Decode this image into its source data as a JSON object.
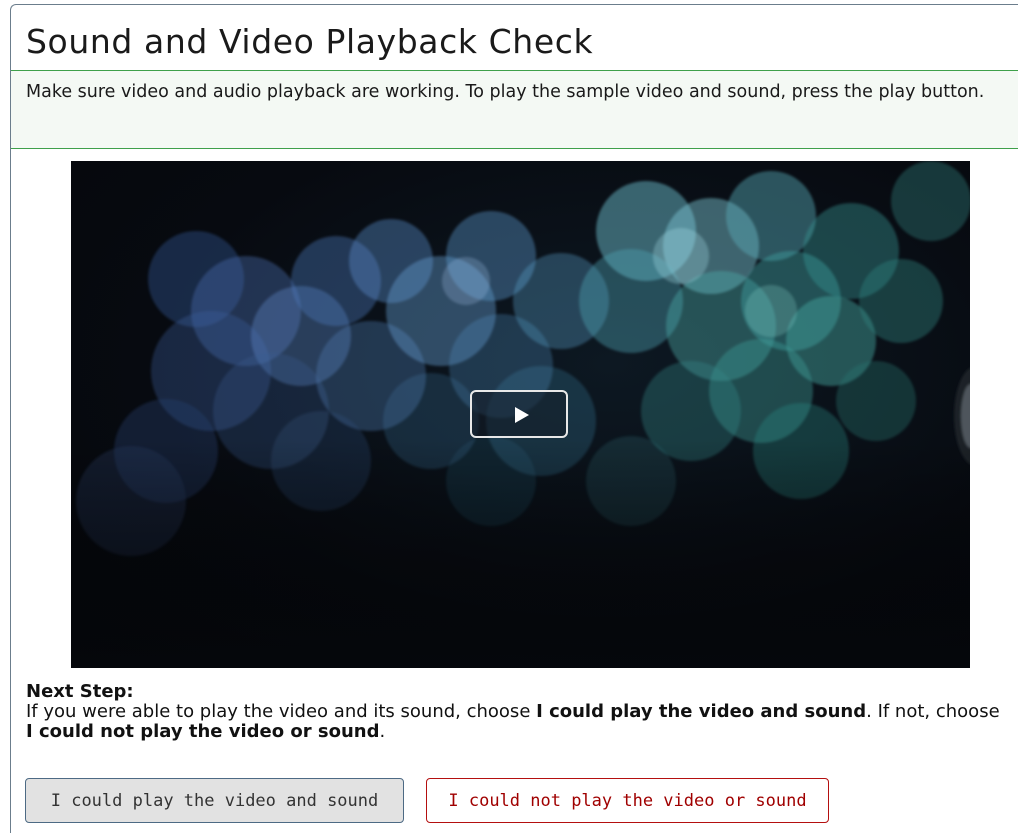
{
  "page": {
    "title": "Sound and Video Playback Check",
    "instructions": "Make sure video and audio playback are working. To play the sample video and sound, press the play button."
  },
  "video": {
    "play_icon": "play-icon"
  },
  "next_step": {
    "heading": "Next Step:",
    "text_1": "If you were able to play the video and its sound, choose ",
    "bold_1": "I could play the video and sound",
    "text_2": ". If not, choose ",
    "bold_2": "I could not play the video or sound",
    "text_3": "."
  },
  "buttons": {
    "could_play": "I could play the video and sound",
    "could_not_play": "I could not play the video or sound"
  },
  "colors": {
    "accent_green": "#3ea04a",
    "error_red": "#a00000",
    "frame_border": "#6b7d8c"
  }
}
